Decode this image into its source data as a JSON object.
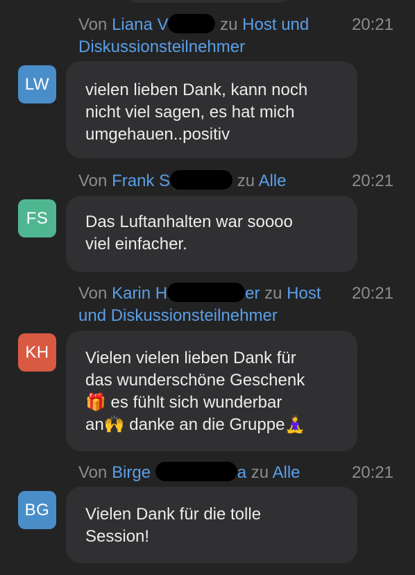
{
  "messages": [
    {
      "from_label": "Von",
      "sender_visible_start": "Liana V",
      "sender_visible_end": "",
      "to_label": "zu",
      "recipient": "Host und Diskussionsteilnehmer",
      "time": "20:21",
      "initials": "LW",
      "avatar_color": "#4a8ec9",
      "text": "vielen lieben Dank, kann noch\nnicht viel sagen, es hat mich\numgehauen..positiv"
    },
    {
      "from_label": "Von",
      "sender_visible_start": "Frank S",
      "sender_visible_end": "",
      "to_label": "zu",
      "recipient": "Alle",
      "time": "20:21",
      "initials": "FS",
      "avatar_color": "#4fb691",
      "text": "Das Luftanhalten war soooo\nviel einfacher."
    },
    {
      "from_label": "Von",
      "sender_visible_start": "Karin H",
      "sender_visible_end": "er",
      "to_label": "zu",
      "recipient": "Host und Diskussionsteilnehmer",
      "time": "20:21",
      "initials": "KH",
      "avatar_color": "#d85a42",
      "text": "Vielen vielen lieben Dank für\ndas wunderschöne Geschenk\n🎁 es fühlt sich wunderbar\nan🙌 danke an die Gruppe🧘‍♀️"
    },
    {
      "from_label": "Von",
      "sender_visible_start": "Birge",
      "sender_visible_end": "a",
      "to_label": "zu",
      "recipient": "Alle",
      "time": "20:21",
      "initials": "BG",
      "avatar_color": "#4a8ec9",
      "text": "Vielen Dank für die tolle\nSession!"
    }
  ]
}
